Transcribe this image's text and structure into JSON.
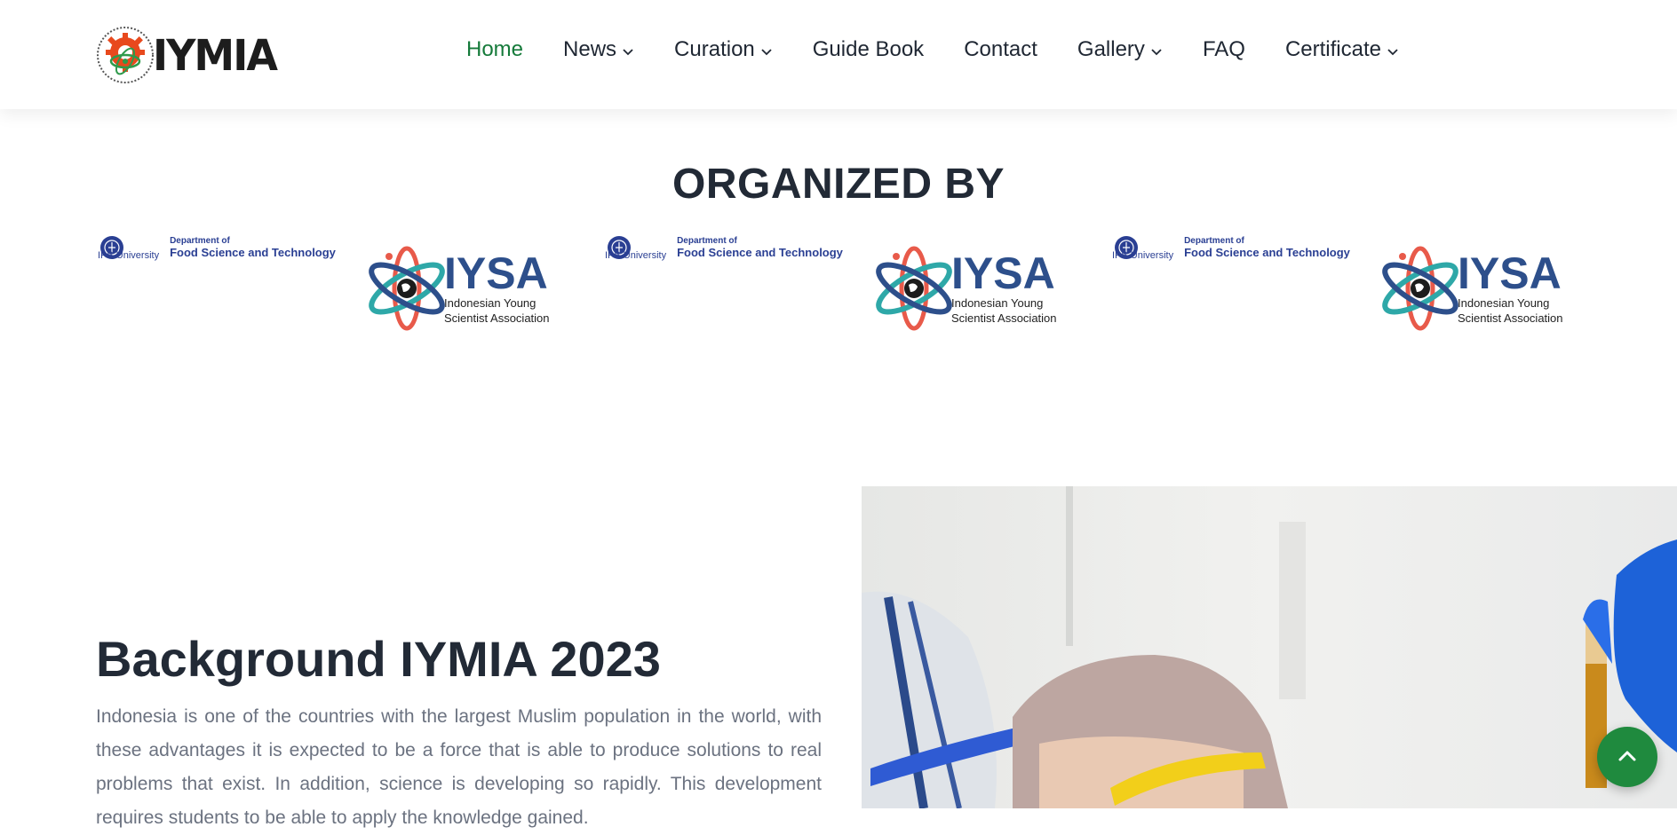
{
  "header": {
    "logo_text": "IYMIA",
    "nav": [
      {
        "label": "Home",
        "dropdown": false,
        "active": true
      },
      {
        "label": "News",
        "dropdown": true
      },
      {
        "label": "Curation",
        "dropdown": true
      },
      {
        "label": "Guide Book",
        "dropdown": false
      },
      {
        "label": "Contact",
        "dropdown": false
      },
      {
        "label": "Gallery",
        "dropdown": true
      },
      {
        "label": "FAQ",
        "dropdown": false
      },
      {
        "label": "Certificate",
        "dropdown": true
      }
    ]
  },
  "organized": {
    "title": "ORGANIZED BY",
    "ipb": {
      "university": "IPB University",
      "dept_line1": "Department of",
      "dept_line2": "Food Science and Technology"
    },
    "iysa": {
      "name": "IYSA",
      "line1": "Indonesian Young",
      "line2": "Scientist Association"
    }
  },
  "background": {
    "title": "Background IYMIA 2023",
    "text": "Indonesia is one of the countries with the largest Muslim population in the world, with these advantages it is expected to be a force that is able to produce solutions to real problems that exist. In addition, science is developing so rapidly. This development requires students to be able to apply the knowledge gained."
  },
  "colors": {
    "active_nav": "#157a3a",
    "heading": "#222a36",
    "body_text": "#6b7280",
    "top_button": "#1f8a3e"
  }
}
